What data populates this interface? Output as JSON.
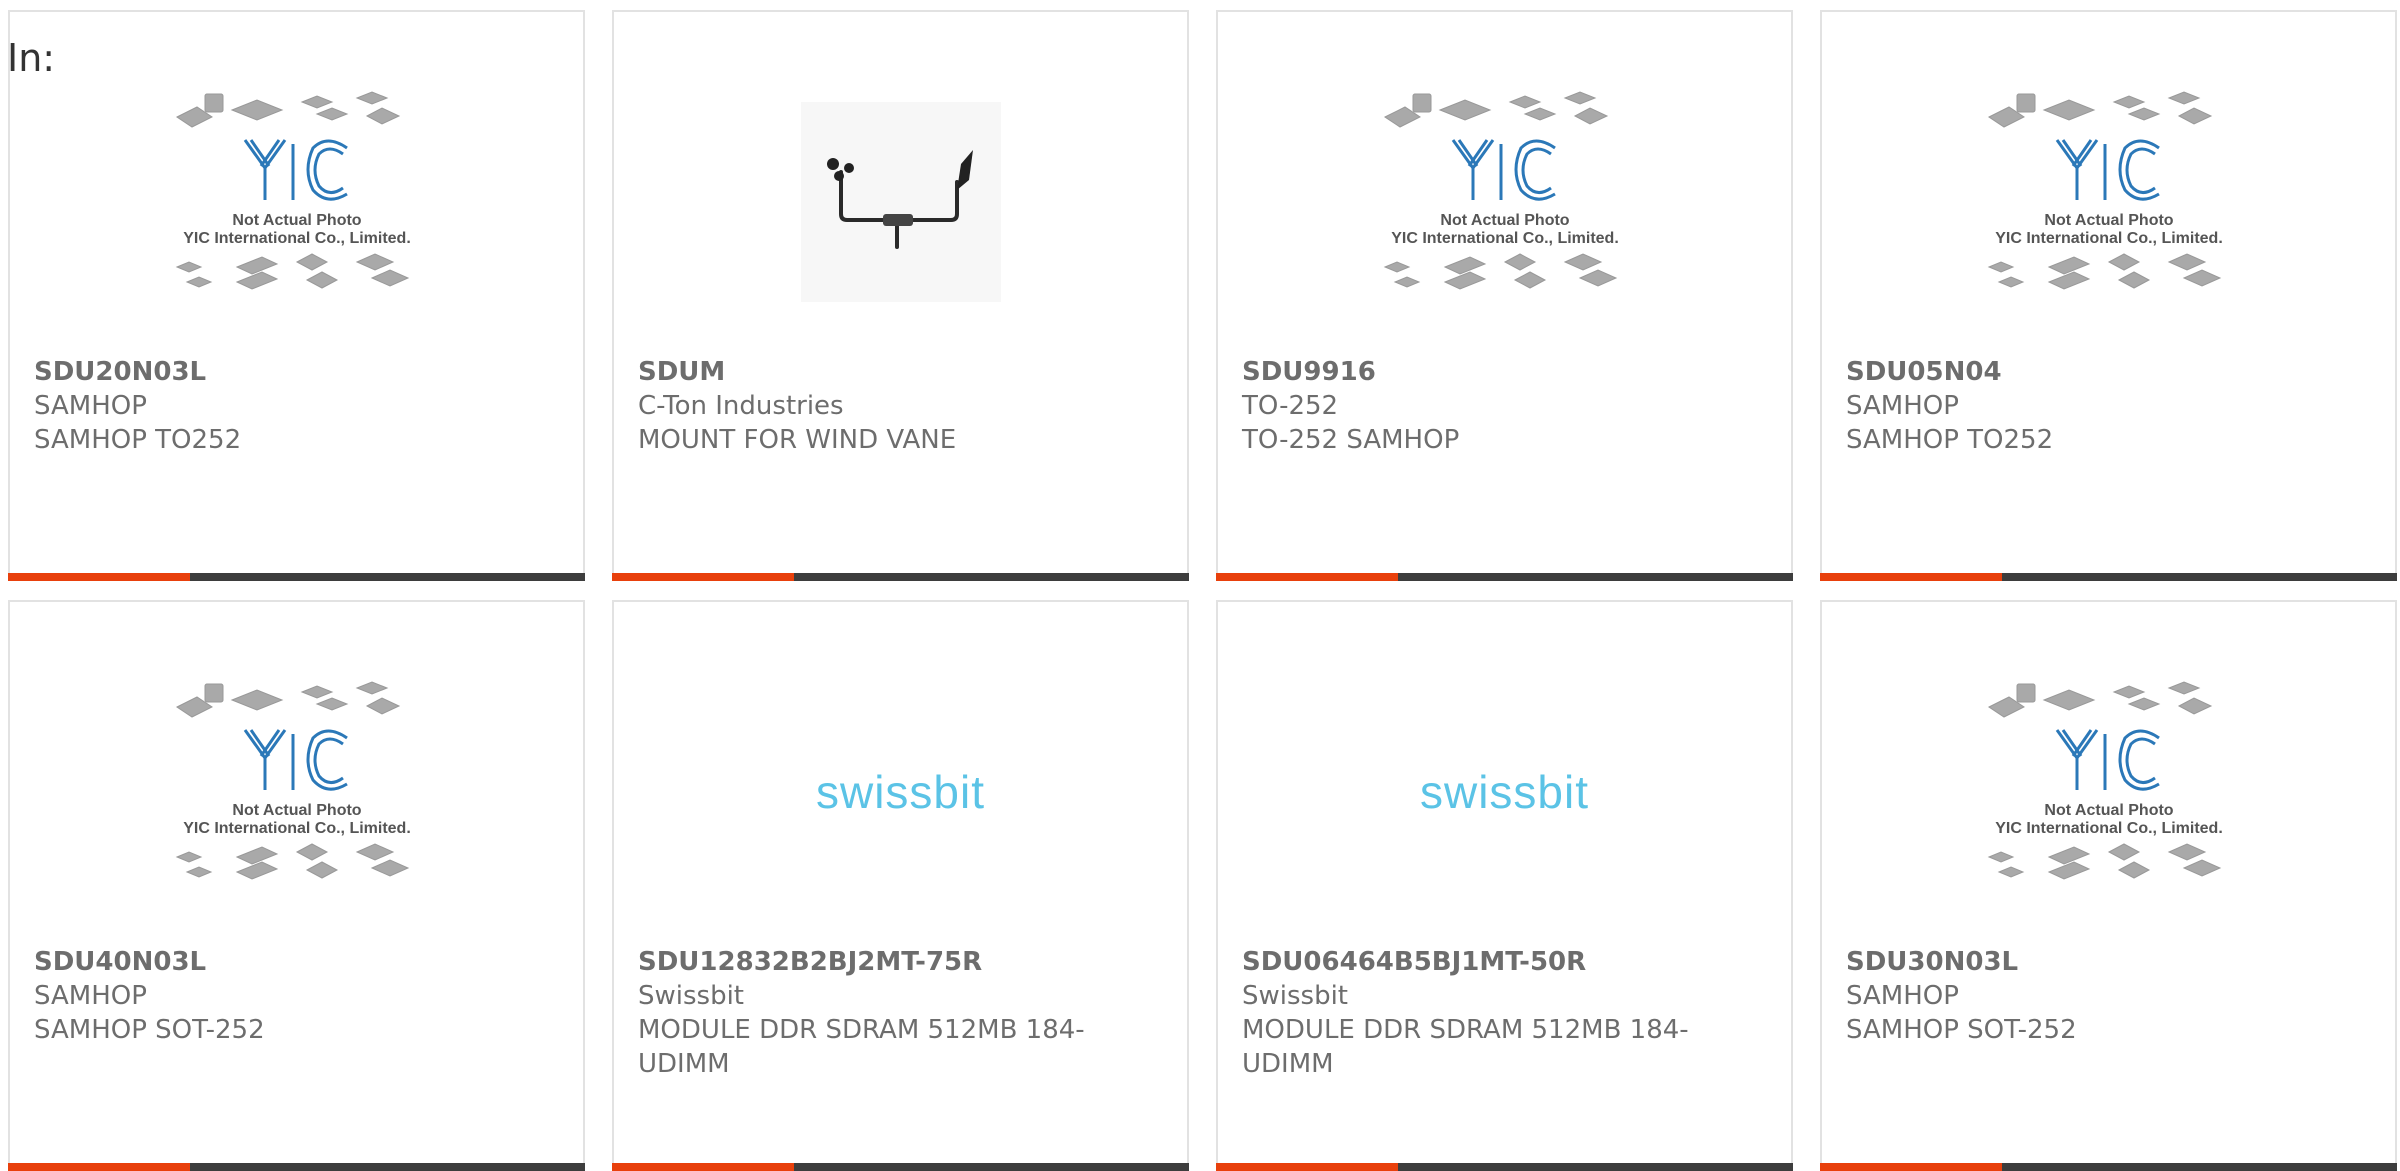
{
  "header": {
    "label": "In:"
  },
  "accent_colors": {
    "bar_accent": "#e8400c",
    "bar_base": "#3d3d3d",
    "yic_blue": "#2b78b8",
    "swissbit_blue": "#5bc3e6"
  },
  "placeholder": {
    "line1": "Not Actual Photo",
    "line2": "YIC International Co., Limited."
  },
  "products": [
    {
      "part": "SDU20N03L",
      "manufacturer": "SAMHOP",
      "description": "SAMHOP TO252",
      "image": "yic-placeholder"
    },
    {
      "part": "SDUM",
      "manufacturer": "C-Ton Industries",
      "description": "MOUNT FOR WIND VANE",
      "image": "wind-vane-photo"
    },
    {
      "part": "SDU9916",
      "manufacturer": "TO-252",
      "description": "TO-252 SAMHOP",
      "image": "yic-placeholder"
    },
    {
      "part": "SDU05N04",
      "manufacturer": "SAMHOP",
      "description": "SAMHOP TO252",
      "image": "yic-placeholder"
    },
    {
      "part": "SDU40N03L",
      "manufacturer": "SAMHOP",
      "description": "SAMHOP SOT-252",
      "image": "yic-placeholder"
    },
    {
      "part": "SDU12832B2BJ2MT-75R",
      "manufacturer": "Swissbit",
      "description": "MODULE DDR SDRAM 512MB 184-UDIMM",
      "image": "swissbit-logo",
      "logo_text": "swissbit"
    },
    {
      "part": "SDU06464B5BJ1MT-50R",
      "manufacturer": "Swissbit",
      "description": "MODULE DDR SDRAM 512MB 184-UDIMM",
      "image": "swissbit-logo",
      "logo_text": "swissbit"
    },
    {
      "part": "SDU30N03L",
      "manufacturer": "SAMHOP",
      "description": "SAMHOP SOT-252",
      "image": "yic-placeholder"
    }
  ]
}
